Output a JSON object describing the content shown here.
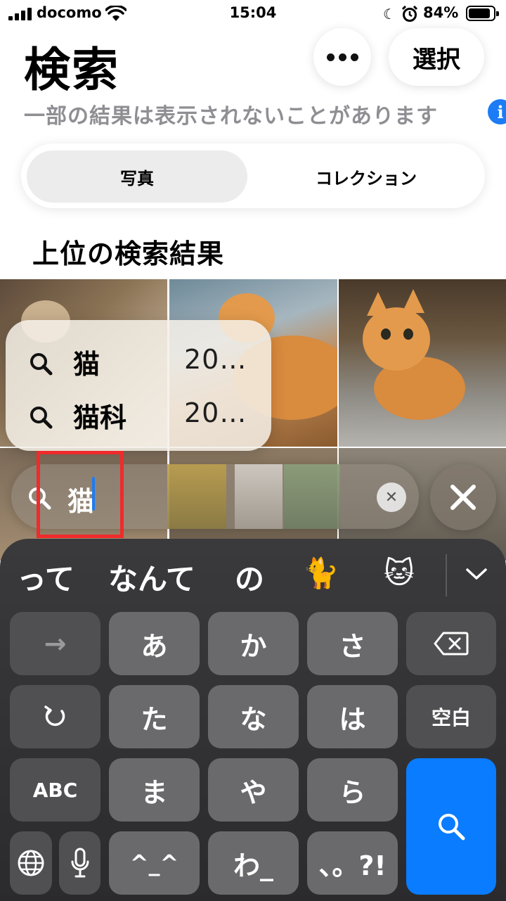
{
  "status_bar": {
    "carrier": "docomo",
    "time": "15:04",
    "battery_percent": "84%",
    "icons": [
      "signal-icon",
      "wifi-icon",
      "moon-icon",
      "alarm-icon",
      "battery-icon"
    ]
  },
  "header": {
    "title": "検索",
    "more_icon": "ellipsis-icon",
    "select_label": "選択",
    "notice": "一部の結果は表示されないことがあります",
    "info_icon": "info-icon"
  },
  "segments": {
    "active": "写真",
    "inactive": "コレクション"
  },
  "section_title": "上位の検索結果",
  "suggestions": [
    {
      "text": "猫",
      "count": "20…"
    },
    {
      "text": "猫科",
      "count": "20…"
    }
  ],
  "search": {
    "query": "猫",
    "clear_icon": "clear-icon",
    "close_icon": "close-icon"
  },
  "keyboard": {
    "candidates": [
      "って",
      "なんて",
      "の",
      "🐈",
      "🐱"
    ],
    "chevron_icon": "chevron-down-icon",
    "rows": [
      [
        "→",
        "あ",
        "か",
        "さ",
        "⌫"
      ],
      [
        "↺",
        "た",
        "な",
        "は",
        "空白"
      ],
      [
        "ABC",
        "ま",
        "や",
        "ら"
      ],
      [
        "🌐",
        "🎤",
        "^_^",
        "わ_",
        "、。?!"
      ]
    ],
    "search_key_icon": "search-icon"
  },
  "accent_colors": {
    "highlight": "#ef2b2b",
    "info": "#1b7cf5",
    "caret": "#1e7cf0",
    "search_key": "#0a7cff"
  }
}
